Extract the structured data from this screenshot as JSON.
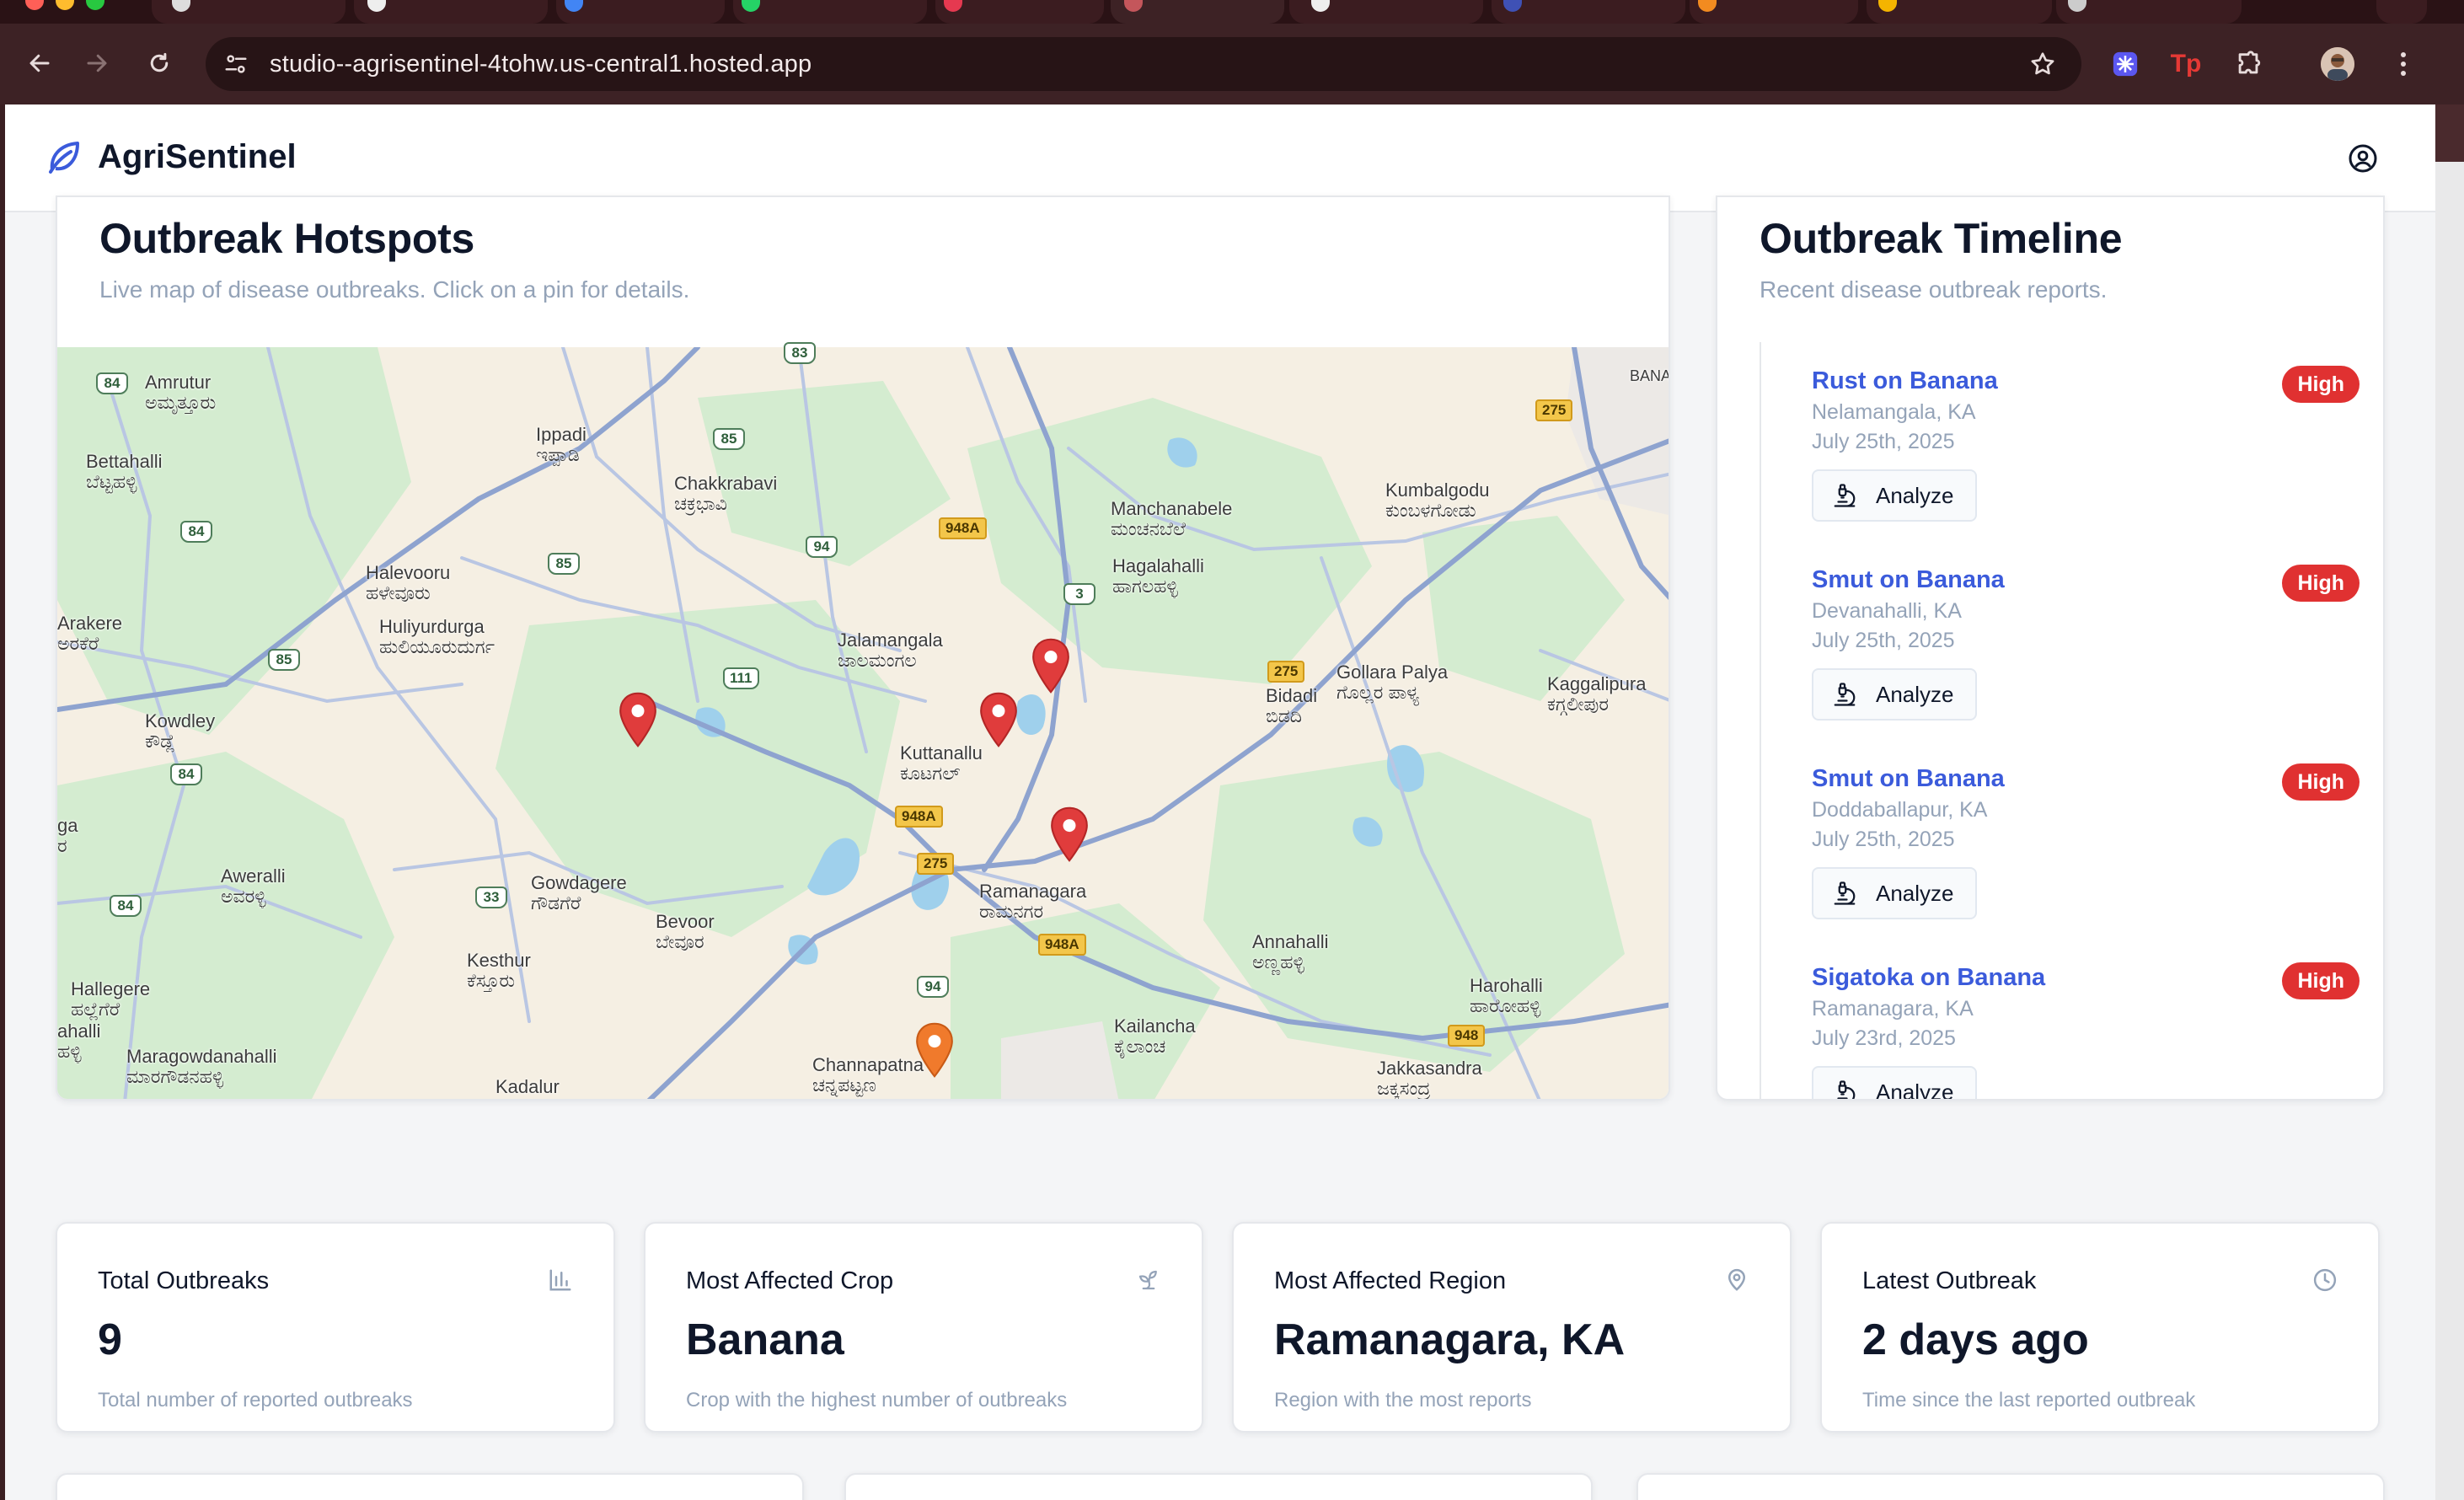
{
  "browser": {
    "url": "studio--agrisentinel-4tohw.us-central1.hosted.app"
  },
  "app": {
    "name": "AgriSentinel"
  },
  "hotspots": {
    "title": "Outbreak Hotspots",
    "subtitle": "Live map of disease outbreaks. Click on a pin for details.",
    "places": [
      {
        "en": "Amrutur",
        "kn": "ಅಮೃತ್ತೂರು"
      },
      {
        "en": "Bettahalli",
        "kn": "ಬೆಟ್ಟಹಳ್ಳಿ"
      },
      {
        "en": "Ippadi",
        "kn": "ಇಪ್ಪಾಡಿ"
      },
      {
        "en": "Chakkrabavi",
        "kn": "ಚಕ್ರಭಾವಿ"
      },
      {
        "en": "Manchanabele",
        "kn": "ಮಂಚನಬೆಲೆ"
      },
      {
        "en": "Kumbalgodu",
        "kn": "ಕುಂಬಳಗೋಡು"
      },
      {
        "en": "Halevooru",
        "kn": "ಹಳೇವೂರು"
      },
      {
        "en": "Hagalahalli",
        "kn": "ಹಾಗಲಹಳ್ಳಿ"
      },
      {
        "en": "Arakere",
        "kn": "ಅರಕೆರೆ"
      },
      {
        "en": "Huliyurdurga",
        "kn": "ಹುಲಿಯೂರುದುರ್ಗ"
      },
      {
        "en": "Jalamangala",
        "kn": "ಜಾಲಮಂಗಲ"
      },
      {
        "en": "Gollara Palya",
        "kn": "ಗೊಲ್ಲರ ಪಾಳ್ಯ"
      },
      {
        "en": "Kaggalipura",
        "kn": "ಕಗ್ಗಲೀಪುರ"
      },
      {
        "en": "Bidadi",
        "kn": "ಬಿಡದಿ"
      },
      {
        "en": "Kowdley",
        "kn": "ಕೌಡ್ಲೆ"
      },
      {
        "en": "Kuttanallu",
        "kn": "ಕೂಟಗಲ್"
      },
      {
        "en": "Aweralli",
        "kn": "ಅವರಳ್ಳಿ"
      },
      {
        "en": "Gowdagere",
        "kn": "ಗೌಡಗೆರೆ"
      },
      {
        "en": "Ramanagara",
        "kn": "ರಾಮನಗರ"
      },
      {
        "en": "Bevoor",
        "kn": "ಬೇವೂರ"
      },
      {
        "en": "Annahalli",
        "kn": "ಅಣ್ಣಹಳ್ಳಿ"
      },
      {
        "en": "Kesthur",
        "kn": "ಕೆಸ್ತೂರು"
      },
      {
        "en": "Harohalli",
        "kn": "ಹಾರೋಹಳ್ಳಿ"
      },
      {
        "en": "Hallegere",
        "kn": "ಹಲ್ಲೆಗೆರೆ"
      },
      {
        "en": "Kailancha",
        "kn": "ಕೈಲಾಂಚ"
      },
      {
        "en": "Maragowdanahalli",
        "kn": "ಮಾರಗೌಡನಹಳ್ಳಿ"
      },
      {
        "en": "Channapatna",
        "kn": "ಚನ್ನಪಟ್ಟಣ"
      },
      {
        "en": "Jakkasandra",
        "kn": "ಜಕ್ಕಸಂದ್ರ"
      },
      {
        "en": "Kadalur",
        "kn": ""
      },
      {
        "en": "ahalli",
        "kn": "ಹಳ್ಳಿ"
      },
      {
        "en": "ga",
        "kn": "ರ"
      },
      {
        "en": "BANA",
        "kn": ""
      }
    ],
    "road_shields": [
      "84",
      "84",
      "84",
      "84",
      "85",
      "85",
      "85",
      "94",
      "94",
      "111",
      "33",
      "3",
      "948A",
      "948A",
      "948A",
      "275",
      "275",
      "275",
      "948",
      "83"
    ],
    "pins": [
      {
        "label": "outbreak",
        "color": "#e03c3c"
      },
      {
        "label": "outbreak",
        "color": "#e03c3c"
      },
      {
        "label": "outbreak",
        "color": "#e03c3c"
      },
      {
        "label": "outbreak",
        "color": "#e03c3c"
      },
      {
        "label": "outbreak",
        "color": "#f07a2c"
      }
    ]
  },
  "timeline": {
    "title": "Outbreak Timeline",
    "subtitle": "Recent disease outbreak reports.",
    "button_label": "Analyze",
    "items": [
      {
        "name": "Rust on Banana",
        "location": "Nelamangala, KA",
        "date": "July 25th, 2025",
        "severity": "High"
      },
      {
        "name": "Smut on Banana",
        "location": "Devanahalli, KA",
        "date": "July 25th, 2025",
        "severity": "High"
      },
      {
        "name": "Smut on Banana",
        "location": "Doddaballapur, KA",
        "date": "July 25th, 2025",
        "severity": "High"
      },
      {
        "name": "Sigatoka on Banana",
        "location": "Ramanagara, KA",
        "date": "July 23rd, 2025",
        "severity": "High"
      }
    ]
  },
  "stats": [
    {
      "label": "Total Outbreaks",
      "value": "9",
      "desc": "Total number of reported outbreaks",
      "icon": "bar-chart-icon"
    },
    {
      "label": "Most Affected Crop",
      "value": "Banana",
      "desc": "Crop with the highest number of outbreaks",
      "icon": "sprout-icon"
    },
    {
      "label": "Most Affected Region",
      "value": "Ramanagara, KA",
      "desc": "Region with the most reports",
      "icon": "map-pin-icon"
    },
    {
      "label": "Latest Outbreak",
      "value": "2 days ago",
      "desc": "Time since the last reported outbreak",
      "icon": "clock-icon"
    }
  ],
  "colors": {
    "brand": "#3b5bdb",
    "badge_high": "#e03131",
    "pin_red": "#e03c3c",
    "pin_orange": "#f07a2c"
  }
}
